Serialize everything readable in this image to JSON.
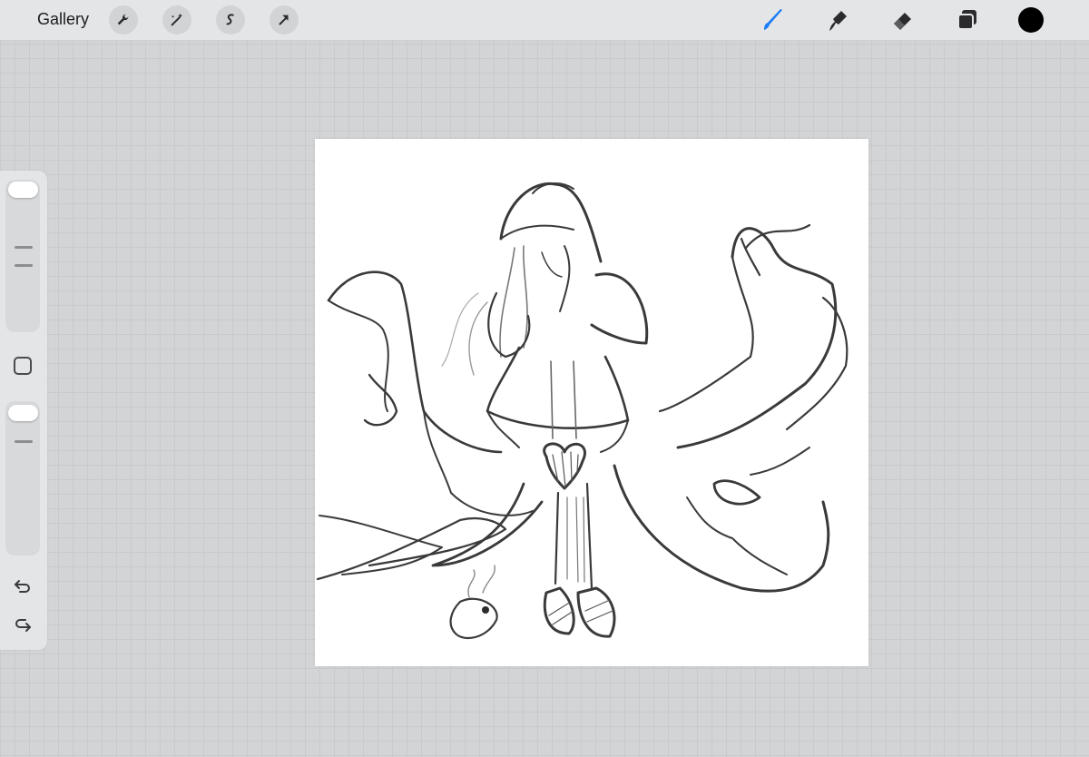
{
  "topbar": {
    "gallery_label": "Gallery",
    "left_tools": [
      "wrench-icon",
      "magic-wand-icon",
      "selection-icon",
      "transform-arrow-icon"
    ],
    "right_tools": [
      "brush-icon",
      "smudge-icon",
      "eraser-icon",
      "layers-icon"
    ],
    "active_tool": "brush-icon",
    "active_color": "#000000",
    "accent_color": "#1a7cf5"
  },
  "sidebar": {
    "brush_size_level": 1.0,
    "opacity_level": 1.0,
    "icons": [
      "modify-square-icon",
      "undo-icon",
      "redo-icon"
    ]
  }
}
